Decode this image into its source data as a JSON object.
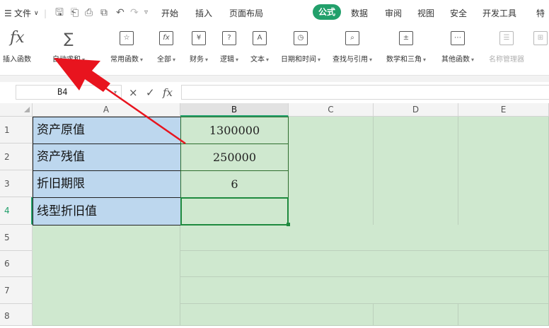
{
  "menubar": {
    "menu_icon": "hamburger-icon",
    "file_label": "文件",
    "tabs": [
      "开始",
      "插入",
      "页面布局",
      "公式",
      "数据",
      "审阅",
      "视图",
      "安全",
      "开发工具",
      "特"
    ],
    "active_tab": "公式",
    "accent_color": "#22a06b"
  },
  "ribbon": {
    "insert_function": "插入函数",
    "auto_sum": "自动求和",
    "common_functions": "常用函数",
    "all": "全部",
    "financial": "财务",
    "logical": "逻辑",
    "text": "文本",
    "datetime": "日期和时间",
    "lookup": "查找与引用",
    "math": "数学和三角",
    "other": "其他函数",
    "name_manager": "名称管理器"
  },
  "formula_bar": {
    "name_box": "B4",
    "cancel_symbol": "×",
    "confirm_symbol": "✓",
    "fx_symbol": "fx",
    "formula": ""
  },
  "sheet": {
    "columns": [
      "A",
      "B",
      "C",
      "D",
      "E"
    ],
    "selected_column": "B",
    "rows": [
      "1",
      "2",
      "3",
      "4",
      "5",
      "6",
      "7",
      "8"
    ],
    "selected_row": "4",
    "cells": {
      "A1": "资产原值",
      "B1": "1300000",
      "A2": "资产残值",
      "B2": "250000",
      "A3": "折旧期限",
      "B3": "6",
      "A4": "线型折旧值",
      "B4": ""
    },
    "label_fill": "#bdd7ee",
    "sheet_fill": "#cfe8cf"
  },
  "annotation": {
    "arrow_color": "#e8141e",
    "points_to": "插入函数"
  }
}
